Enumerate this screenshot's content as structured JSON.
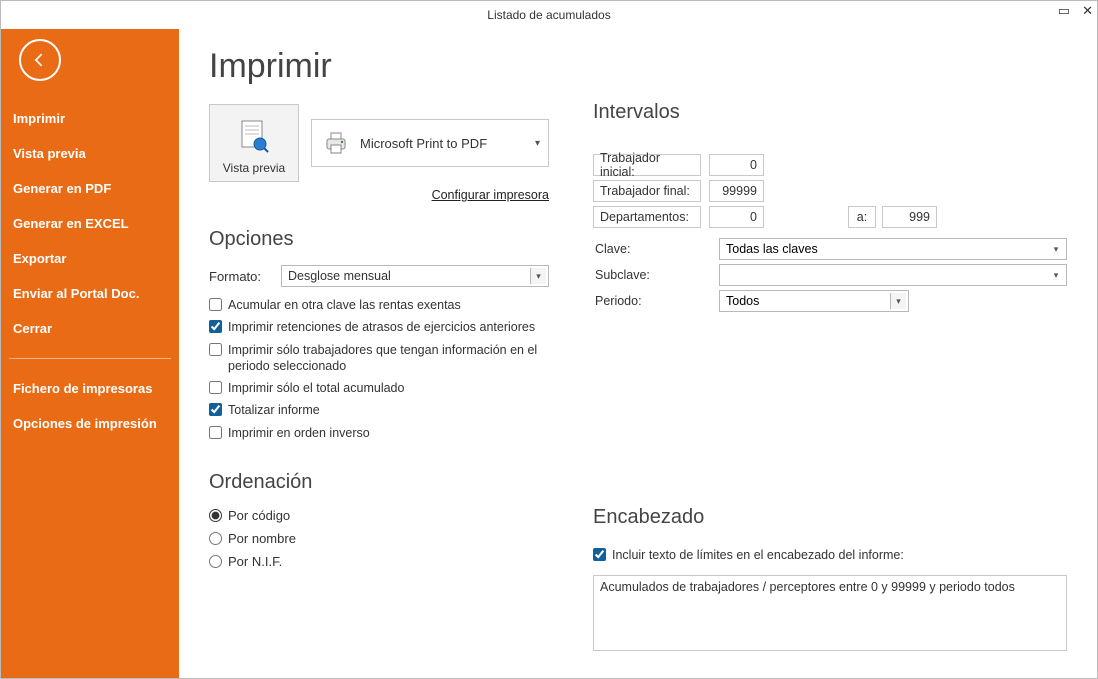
{
  "window": {
    "title": "Listado de acumulados"
  },
  "sidebar": {
    "items": [
      "Imprimir",
      "Vista previa",
      "Generar en PDF",
      "Generar en EXCEL",
      "Exportar",
      "Enviar al Portal Doc.",
      "Cerrar"
    ],
    "extra": [
      "Fichero de impresoras",
      "Opciones de impresión"
    ]
  },
  "page": {
    "heading": "Imprimir"
  },
  "vista_tile": {
    "label": "Vista previa"
  },
  "printer": {
    "name": "Microsoft Print to PDF"
  },
  "config_link": "Configurar impresora",
  "opciones": {
    "heading": "Opciones",
    "formato_label": "Formato:",
    "formato_value": "Desglose mensual",
    "checks": [
      {
        "label": "Acumular en otra clave las rentas exentas",
        "checked": false
      },
      {
        "label": "Imprimir retenciones de atrasos de ejercicios anteriores",
        "checked": true
      },
      {
        "label": "Imprimir sólo trabajadores que tengan información en el periodo seleccionado",
        "checked": false
      },
      {
        "label": "Imprimir sólo el total acumulado",
        "checked": false
      },
      {
        "label": "Totalizar informe",
        "checked": true
      },
      {
        "label": "Imprimir en orden inverso",
        "checked": false
      }
    ]
  },
  "ordenacion": {
    "heading": "Ordenación",
    "options": [
      {
        "label": "Por código",
        "checked": true
      },
      {
        "label": "Por nombre",
        "checked": false
      },
      {
        "label": "Por N.I.F.",
        "checked": false
      }
    ]
  },
  "intervalos": {
    "heading": "Intervalos",
    "trabajador_inicial_label": "Trabajador inicial:",
    "trabajador_inicial_value": "0",
    "trabajador_final_label": "Trabajador final:",
    "trabajador_final_value": "99999",
    "departamentos_label": "Departamentos:",
    "departamentos_from": "0",
    "departamentos_to_label": "a:",
    "departamentos_to": "999",
    "clave_label": "Clave:",
    "clave_value": "Todas las claves",
    "subclave_label": "Subclave:",
    "subclave_value": "",
    "periodo_label": "Periodo:",
    "periodo_value": "Todos"
  },
  "encabezado": {
    "heading": "Encabezado",
    "check_label": "Incluir texto de límites en el encabezado del informe:",
    "check_checked": true,
    "text": "Acumulados de trabajadores / perceptores entre 0 y 99999 y periodo todos"
  }
}
